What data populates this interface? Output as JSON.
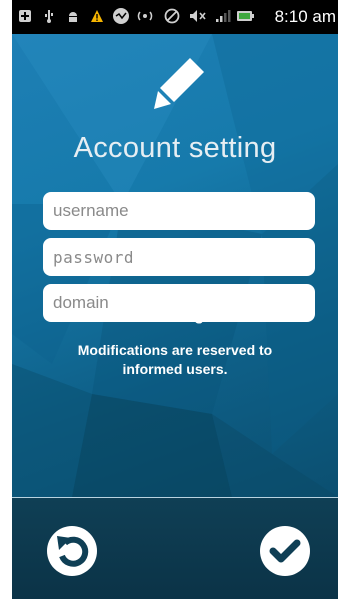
{
  "status_bar": {
    "time": "8:10 am",
    "icons": [
      "add-icon",
      "usb-icon",
      "android-icon",
      "warning-icon",
      "sync-icon",
      "wireless-icon",
      "blocked-icon",
      "mute-icon",
      "signal-icon",
      "battery-icon"
    ]
  },
  "header": {
    "icon": "pencil-icon",
    "title": "Account setting"
  },
  "form": {
    "username_placeholder": "username",
    "password_placeholder": "password",
    "domain_placeholder": "domain"
  },
  "warning": {
    "title": "Warning!",
    "message": "Modifications are reserved to informed users."
  },
  "bottom_bar": {
    "left_icon": "undo-icon",
    "right_icon": "checkmark-icon"
  },
  "colors": {
    "main_background": "#167aab",
    "bottom_bar": "#0f3f55",
    "accent_dark": "#0b3347",
    "text": "#ffffff"
  }
}
